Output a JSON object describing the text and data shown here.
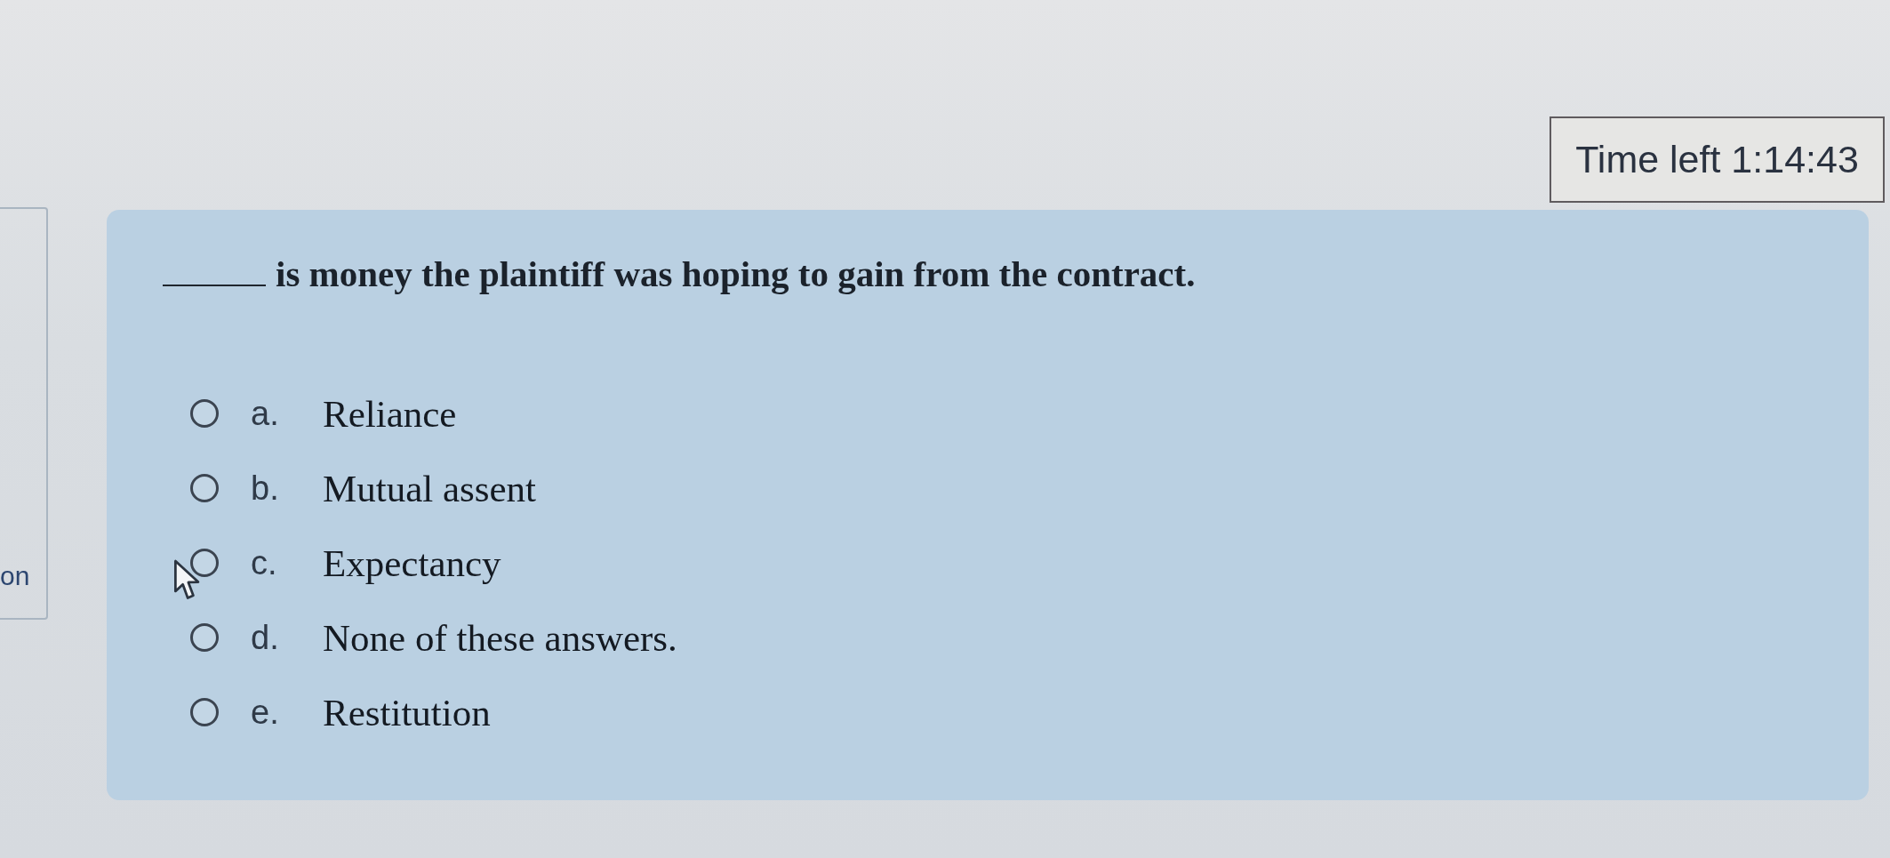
{
  "timer": {
    "text": "Time left 1:14:43"
  },
  "side_panel": {
    "text": "on"
  },
  "question": {
    "blank": true,
    "text": "is money the plaintiff was hoping to gain from the contract."
  },
  "options": [
    {
      "letter": "a.",
      "text": "Reliance",
      "selected": false
    },
    {
      "letter": "b.",
      "text": "Mutual assent",
      "selected": false
    },
    {
      "letter": "c.",
      "text": "Expectancy",
      "selected": false
    },
    {
      "letter": "d.",
      "text": "None of these answers.",
      "selected": false
    },
    {
      "letter": "e.",
      "text": "Restitution",
      "selected": false
    }
  ]
}
